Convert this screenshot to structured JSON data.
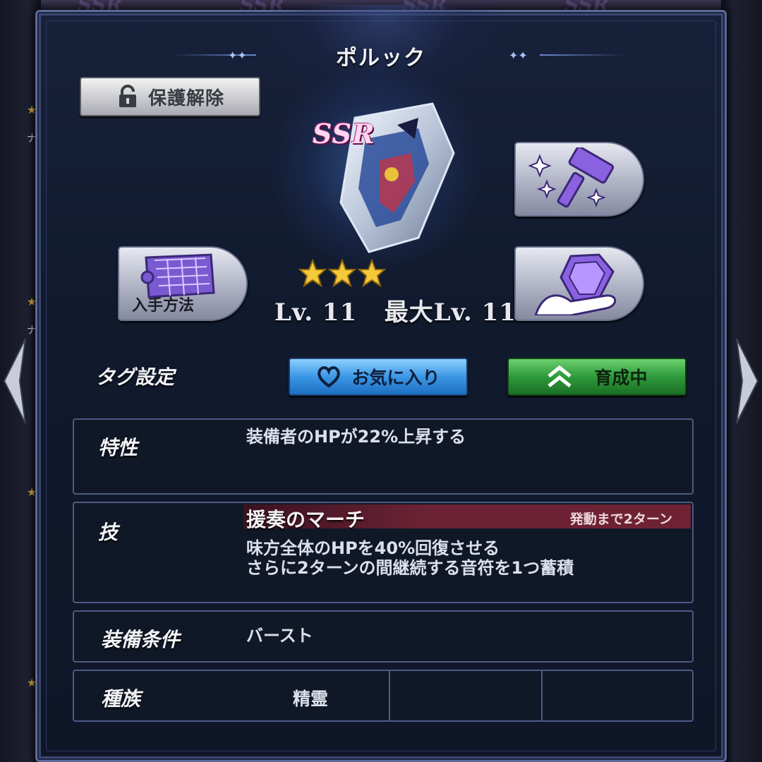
{
  "background": {
    "strip_text": [
      "SSR",
      "SSR",
      "SSR",
      "SSR"
    ],
    "side_label": "ナ"
  },
  "dialog": {
    "title": "ポルック",
    "unlock_button": "保護解除",
    "rarity": "SSR",
    "stars": 3,
    "level_text": "Lv. 11   最大Lv. 11",
    "acquire_button": "入手方法",
    "tag_section_label": "タグ設定",
    "favorite_button": "お気に入り",
    "training_button": "育成中",
    "trait": {
      "label": "特性",
      "text": "装備者のHPが22%上昇する"
    },
    "skill": {
      "label": "技",
      "name": "援奏のマーチ",
      "turns": "発動まで2ターン",
      "line1": "味方全体のHPを40%回復させる",
      "line2": "さらに2ターンの間継続する音符を1つ蓄積"
    },
    "equip_condition": {
      "label": "装備条件",
      "value": "バースト"
    },
    "race": {
      "label": "種族",
      "value": "精霊"
    }
  },
  "colors": {
    "favorite": "#3b96e6",
    "training": "#2e9a3a",
    "skill_bar": "#6a2234",
    "panel_border": "#5b6a96"
  },
  "icons": [
    "lock-open-icon",
    "heart-icon",
    "double-chevron-up-icon",
    "scroll-map-icon",
    "hammer-sparkle-icon",
    "gem-hand-icon",
    "star-icon",
    "chevron-left-icon",
    "chevron-right-icon"
  ]
}
